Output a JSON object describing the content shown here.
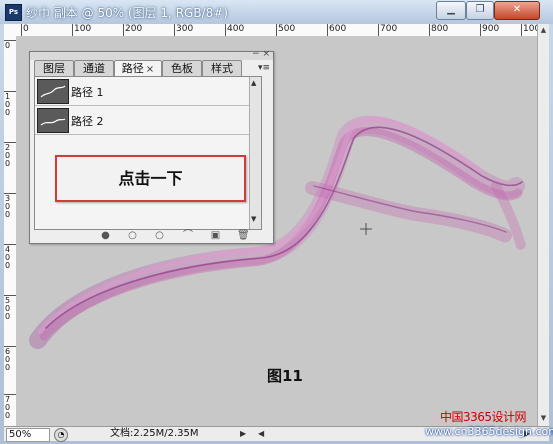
{
  "window": {
    "title": "纱巾 副本 @ 50% (图层 1, RGB/8#)",
    "app_icon": "Ps",
    "controls": {
      "minimize": "▁",
      "restore": "❐",
      "close": "✕"
    }
  },
  "ruler": {
    "h_labels": [
      "0",
      "100",
      "200",
      "300",
      "400",
      "500",
      "600",
      "700",
      "800",
      "900",
      "1000"
    ],
    "v_labels": [
      "0",
      "100",
      "200",
      "300",
      "400",
      "500",
      "600",
      "700"
    ]
  },
  "paths_panel": {
    "tabs": [
      {
        "label": "图层",
        "active": false
      },
      {
        "label": "通道",
        "active": false
      },
      {
        "label": "路径",
        "active": true,
        "close": "×"
      },
      {
        "label": "色板",
        "active": false
      },
      {
        "label": "样式",
        "active": false
      }
    ],
    "items": [
      {
        "label": "路径 1"
      },
      {
        "label": "路径 2"
      }
    ],
    "footer_icons": [
      "fill-path-icon",
      "stroke-path-icon",
      "load-selection-icon",
      "make-work-path-icon",
      "new-path-icon",
      "trash-icon"
    ]
  },
  "callout": {
    "text": "点击一下"
  },
  "figure_label": "图11",
  "status": {
    "zoom": "50%",
    "doc": "文档:2.25M/2.35M"
  },
  "watermark": {
    "line1": "中国3365设计网",
    "line2": "www.cn3365design.com"
  },
  "colors": {
    "silk": "#c46bb0",
    "silk_dark": "#8e3b88",
    "callout_border": "#d03c3c"
  }
}
